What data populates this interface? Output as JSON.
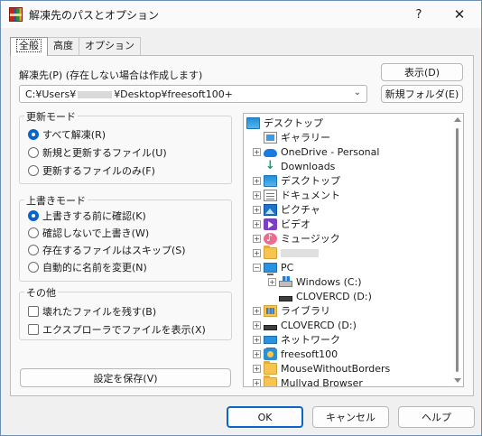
{
  "window": {
    "title": "解凍先のパスとオプション",
    "help": "?",
    "close": "✕"
  },
  "tabs": [
    {
      "label": "全般"
    },
    {
      "label": "高度"
    },
    {
      "label": "オプション"
    }
  ],
  "dest": {
    "label": "解凍先(P) (存在しない場合は作成します)",
    "path_prefix": "C:¥Users¥",
    "path_suffix": "¥Desktop¥freesoft100+",
    "show_button": "表示(D)",
    "new_folder_button": "新規フォルダ(E)"
  },
  "update_mode": {
    "title": "更新モード",
    "options": [
      {
        "label": "すべて解凍(R)",
        "selected": true
      },
      {
        "label": "新規と更新するファイル(U)",
        "selected": false
      },
      {
        "label": "更新するファイルのみ(F)",
        "selected": false
      }
    ]
  },
  "overwrite_mode": {
    "title": "上書きモード",
    "options": [
      {
        "label": "上書きする前に確認(K)",
        "selected": true
      },
      {
        "label": "確認しないで上書き(W)",
        "selected": false
      },
      {
        "label": "存在するファイルはスキップ(S)",
        "selected": false
      },
      {
        "label": "自動的に名前を変更(N)",
        "selected": false
      }
    ]
  },
  "other": {
    "title": "その他",
    "options": [
      {
        "label": "壊れたファイルを残す(B)",
        "checked": false
      },
      {
        "label": "エクスプローラでファイルを表示(X)",
        "checked": false
      }
    ]
  },
  "save_settings_button": "設定を保存(V)",
  "tree": [
    {
      "label": "デスクトップ",
      "icon": "desktop-icon"
    },
    {
      "label": "ギャラリー",
      "icon": "gallery-icon"
    },
    {
      "label": "OneDrive - Personal",
      "icon": "cloud-icon"
    },
    {
      "label": "Downloads",
      "icon": "download-icon"
    },
    {
      "label": "デスクトップ",
      "icon": "desktop-icon"
    },
    {
      "label": "ドキュメント",
      "icon": "document-icon"
    },
    {
      "label": "ピクチャ",
      "icon": "pictures-icon"
    },
    {
      "label": "ビデオ",
      "icon": "video-icon"
    },
    {
      "label": "ミュージック",
      "icon": "music-icon"
    },
    {
      "label": "",
      "icon": "folder-icon"
    },
    {
      "label": "PC",
      "icon": "pc-icon"
    },
    {
      "label": "Windows (C:)",
      "icon": "windows-drive-icon"
    },
    {
      "label": "CLOVERCD (D:)",
      "icon": "drive-icon"
    },
    {
      "label": "ライブラリ",
      "icon": "library-icon"
    },
    {
      "label": "CLOVERCD (D:)",
      "icon": "drive-icon"
    },
    {
      "label": "ネットワーク",
      "icon": "network-icon"
    },
    {
      "label": "freesoft100",
      "icon": "freesoft-icon"
    },
    {
      "label": "MouseWithoutBorders",
      "icon": "folder-icon"
    },
    {
      "label": "Mullvad Browser",
      "icon": "folder-icon"
    }
  ],
  "footer": {
    "ok": "OK",
    "cancel": "キャンセル",
    "help": "ヘルプ"
  },
  "colors": {
    "accent": "#0c66c7",
    "window_bg": "#f0f0f0",
    "panel_bg": "#f9f9f9"
  }
}
